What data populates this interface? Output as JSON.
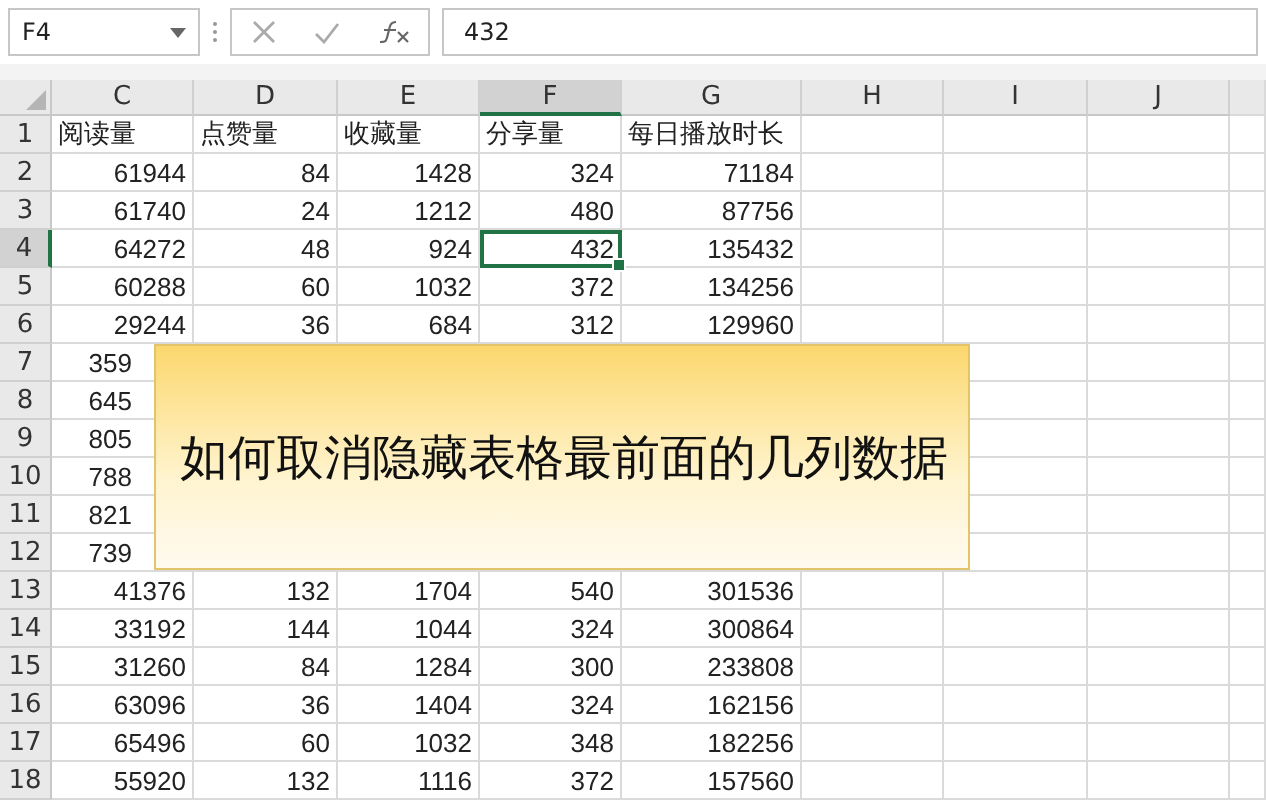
{
  "formula_bar": {
    "name_box": "F4",
    "value": "432"
  },
  "columns": [
    {
      "label": "C",
      "selected": false
    },
    {
      "label": "D",
      "selected": false
    },
    {
      "label": "E",
      "selected": false
    },
    {
      "label": "F",
      "selected": true
    },
    {
      "label": "G",
      "selected": false
    },
    {
      "label": "H",
      "selected": false
    },
    {
      "label": "I",
      "selected": false
    },
    {
      "label": "J",
      "selected": false
    }
  ],
  "rows": [
    {
      "label": "1",
      "selected": false,
      "kind": "header",
      "cells": [
        "阅读量",
        "点赞量",
        "收藏量",
        "分享量",
        "每日播放时长"
      ]
    },
    {
      "label": "2",
      "selected": false,
      "kind": "data",
      "cells": [
        "61944",
        "84",
        "1428",
        "324",
        "71184"
      ]
    },
    {
      "label": "3",
      "selected": false,
      "kind": "data",
      "cells": [
        "61740",
        "24",
        "1212",
        "480",
        "87756"
      ]
    },
    {
      "label": "4",
      "selected": true,
      "kind": "data",
      "cells": [
        "64272",
        "48",
        "924",
        "432",
        "135432"
      ]
    },
    {
      "label": "5",
      "selected": false,
      "kind": "data",
      "cells": [
        "60288",
        "60",
        "1032",
        "372",
        "134256"
      ]
    },
    {
      "label": "6",
      "selected": false,
      "kind": "data",
      "cells": [
        "29244",
        "36",
        "684",
        "312",
        "129960"
      ]
    },
    {
      "label": "7",
      "selected": false,
      "kind": "covered",
      "cells": [
        "359"
      ]
    },
    {
      "label": "8",
      "selected": false,
      "kind": "covered",
      "cells": [
        "645"
      ]
    },
    {
      "label": "9",
      "selected": false,
      "kind": "covered",
      "cells": [
        "805"
      ]
    },
    {
      "label": "10",
      "selected": false,
      "kind": "covered",
      "cells": [
        "788"
      ]
    },
    {
      "label": "11",
      "selected": false,
      "kind": "covered",
      "cells": [
        "821"
      ]
    },
    {
      "label": "12",
      "selected": false,
      "kind": "covered",
      "cells": [
        "739"
      ]
    },
    {
      "label": "13",
      "selected": false,
      "kind": "data",
      "cells": [
        "41376",
        "132",
        "1704",
        "540",
        "301536"
      ]
    },
    {
      "label": "14",
      "selected": false,
      "kind": "data",
      "cells": [
        "33192",
        "144",
        "1044",
        "324",
        "300864"
      ]
    },
    {
      "label": "15",
      "selected": false,
      "kind": "data",
      "cells": [
        "31260",
        "84",
        "1284",
        "300",
        "233808"
      ]
    },
    {
      "label": "16",
      "selected": false,
      "kind": "data",
      "cells": [
        "63096",
        "36",
        "1404",
        "324",
        "162156"
      ]
    },
    {
      "label": "17",
      "selected": false,
      "kind": "data",
      "cells": [
        "65496",
        "60",
        "1032",
        "348",
        "182256"
      ]
    },
    {
      "label": "18",
      "selected": false,
      "kind": "data",
      "cells": [
        "55920",
        "132",
        "1116",
        "372",
        "157560"
      ]
    }
  ],
  "overlay": {
    "title": "如何取消隐藏表格最前面的几列数据"
  }
}
